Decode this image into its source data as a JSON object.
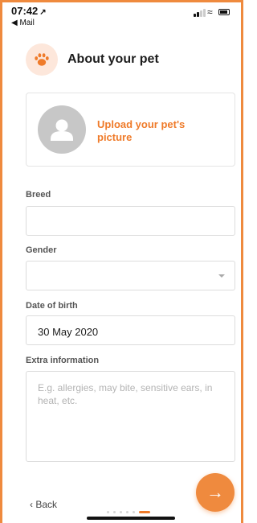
{
  "status_bar": {
    "time": "07:42",
    "location_arrow": "↗",
    "back_app": "◀ Mail",
    "wifi_glyph": "≈"
  },
  "header": {
    "title": "About your pet",
    "icon": "paw-icon"
  },
  "upload": {
    "label": "Upload your pet's picture",
    "icon": "user-avatar-icon"
  },
  "form": {
    "breed": {
      "label": "Breed",
      "value": ""
    },
    "gender": {
      "label": "Gender",
      "value": "",
      "icon": "chevron-down-icon"
    },
    "dob": {
      "label": "Date of birth",
      "value": "30 May 2020"
    },
    "extra": {
      "label": "Extra information",
      "placeholder": "E.g. allergies, may bite, sensitive ears, in heat, etc."
    }
  },
  "footer": {
    "back_label": "‹  Back",
    "next_glyph": "→",
    "steps_total": 6,
    "current_step": 6
  },
  "colors": {
    "accent": "#ef8a3e",
    "accent_text": "#ef7b2a",
    "paw_bg": "#fde7db"
  }
}
